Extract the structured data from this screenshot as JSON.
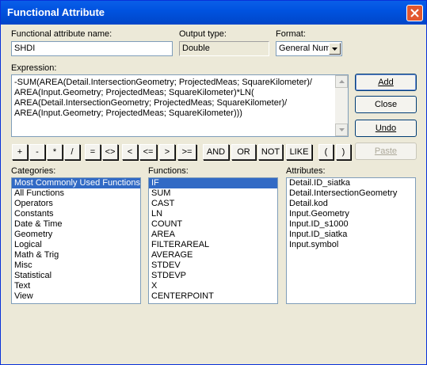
{
  "window": {
    "title": "Functional Attribute"
  },
  "name_field": {
    "label": "Functional attribute name:",
    "value": "SHDI"
  },
  "output_type": {
    "label": "Output type:",
    "value": "Double"
  },
  "format": {
    "label": "Format:",
    "value": "General Num"
  },
  "expression": {
    "label": "Expression:",
    "lines": [
      "-SUM(AREA(Detail.IntersectionGeometry; ProjectedMeas; SquareKilometer)/",
      "AREA(Input.Geometry; ProjectedMeas; SquareKilometer)*LN(",
      "AREA(Detail.IntersectionGeometry; ProjectedMeas; SquareKilometer)/",
      "AREA(Input.Geometry; ProjectedMeas; SquareKilometer)))"
    ]
  },
  "buttons": {
    "add": "Add",
    "close": "Close",
    "undo": "Undo",
    "paste": "Paste"
  },
  "operators": [
    "+",
    "-",
    "*",
    "/",
    "=",
    "<>",
    "<",
    "<=",
    ">",
    ">=",
    "AND",
    "OR",
    "NOT",
    "LIKE",
    "(",
    ")"
  ],
  "categories": {
    "label": "Categories:",
    "selected": 0,
    "items": [
      "Most Commonly Used Functions",
      "All Functions",
      "Operators",
      "Constants",
      "Date & Time",
      "Geometry",
      "Logical",
      "Math & Trig",
      "Misc",
      "Statistical",
      "Text",
      "View"
    ]
  },
  "functions": {
    "label": "Functions:",
    "selected": 0,
    "items": [
      "IF",
      "SUM",
      "CAST",
      "LN",
      "COUNT",
      "AREA",
      "FILTERAREAL",
      "AVERAGE",
      "STDEV",
      "STDEVP",
      "X",
      "CENTERPOINT"
    ]
  },
  "attributes": {
    "label": "Attributes:",
    "items": [
      "Detail.ID_siatka",
      "Detail.IntersectionGeometry",
      "Detail.kod",
      "Input.Geometry",
      "Input.ID_s1000",
      "Input.ID_siatka",
      "Input.symbol"
    ]
  },
  "colors": {
    "title_bar": "#0053e0",
    "selection": "#316ac5",
    "dialog_bg": "#ece9d8"
  }
}
